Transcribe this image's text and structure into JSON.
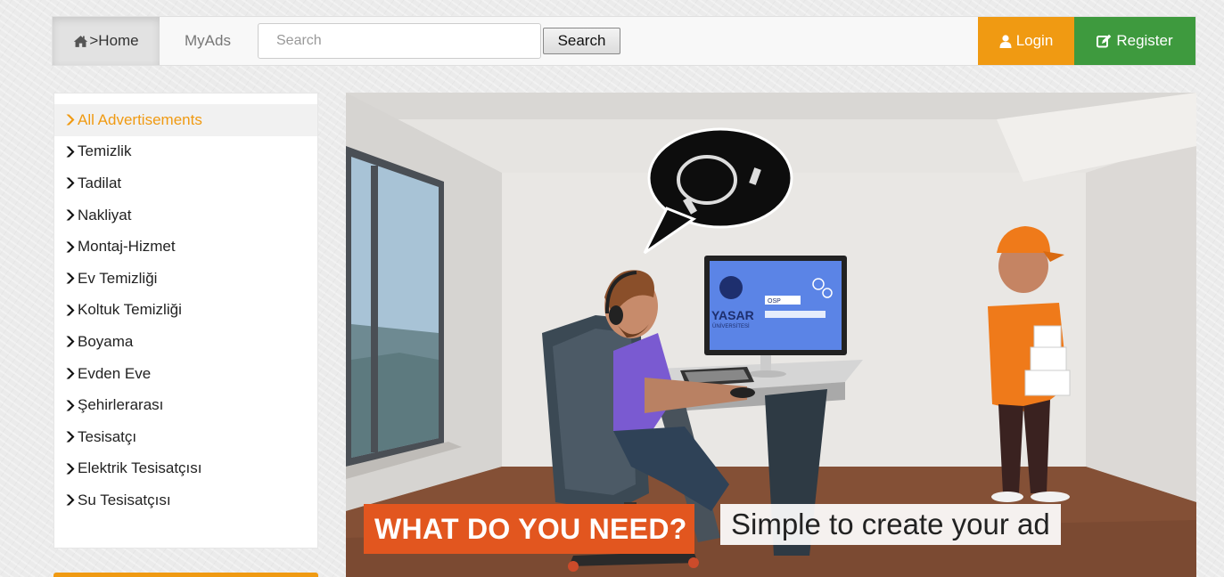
{
  "navbar": {
    "home_label": ">Home",
    "myads_label": "MyAds",
    "search_placeholder": "Search",
    "search_button": "Search",
    "login_label": "Login",
    "register_label": "Register",
    "colors": {
      "login": "#f09a12",
      "register": "#3e9a3e"
    },
    "icons": {
      "home": "home-icon",
      "login": "user-icon",
      "register": "edit-icon"
    }
  },
  "sidebar": {
    "items": [
      {
        "label": "All Advertisements",
        "active": true
      },
      {
        "label": "Temizlik"
      },
      {
        "label": "Tadilat"
      },
      {
        "label": "Nakliyat"
      },
      {
        "label": "Montaj-Hizmet"
      },
      {
        "label": "Ev Temizliği"
      },
      {
        "label": "Koltuk Temizliği"
      },
      {
        "label": "Boyama"
      },
      {
        "label": "Evden Eve"
      },
      {
        "label": "Şehirlerarası"
      },
      {
        "label": "Tesisatçı"
      },
      {
        "label": "Elektrik Tesisatçısı"
      },
      {
        "label": "Su Tesisatçısı"
      }
    ],
    "active_color": "#f09a12"
  },
  "hero": {
    "headline": "WHAT DO YOU NEED?",
    "tagline": "Simple to create your ad",
    "monitor": {
      "brand": "YASAR",
      "brand_sub": "ÜNİVERSİTESİ",
      "chip": "OSP"
    }
  }
}
